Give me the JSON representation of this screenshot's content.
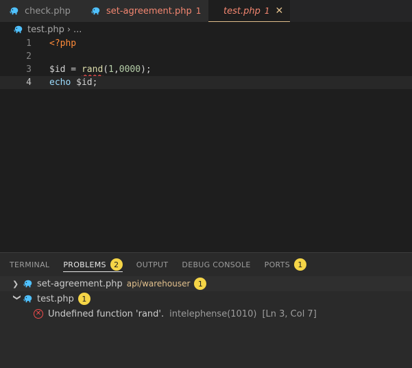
{
  "tabs": [
    {
      "label": "check.php",
      "count": "",
      "icon": "php-elephant-icon"
    },
    {
      "label": "set-agreement.php",
      "count": "1",
      "icon": "php-elephant-icon"
    },
    {
      "label": "test.php",
      "count": "1",
      "icon": "php-elephant-icon",
      "close": "✕"
    }
  ],
  "breadcrumb": {
    "file": "test.php",
    "sep": "›",
    "rest": "..."
  },
  "editor": {
    "lines": [
      {
        "num": "1",
        "text": "<?php"
      },
      {
        "num": "2",
        "text": ""
      },
      {
        "num": "3",
        "text": "$id = rand(1,0000);"
      },
      {
        "num": "4",
        "text": "echo $id;"
      }
    ],
    "line3": {
      "var": "$id",
      "eq": " = ",
      "fn": "rand",
      "open": "(",
      "a": "1",
      "comma": ",",
      "b": "0000",
      "close": ");"
    },
    "line4": {
      "kw": "echo",
      "rest": " $id;"
    }
  },
  "panel": {
    "tabs": [
      {
        "label": "TERMINAL",
        "badge": ""
      },
      {
        "label": "PROBLEMS",
        "badge": "2"
      },
      {
        "label": "OUTPUT",
        "badge": ""
      },
      {
        "label": "DEBUG CONSOLE",
        "badge": ""
      },
      {
        "label": "PORTS",
        "badge": "1"
      }
    ],
    "problems": [
      {
        "file": "set-agreement.php",
        "path": "api/warehouser",
        "count": "1",
        "expanded": false
      },
      {
        "file": "test.php",
        "count": "1",
        "expanded": true,
        "message": "Undefined function 'rand'.",
        "source": "intelephense(1010)",
        "location": "[Ln 3, Col 7]"
      }
    ]
  },
  "colors": {
    "error": "#f14c4c",
    "badge": "#f5d547",
    "modified": "#f48771",
    "warning": "#e2c08d"
  }
}
